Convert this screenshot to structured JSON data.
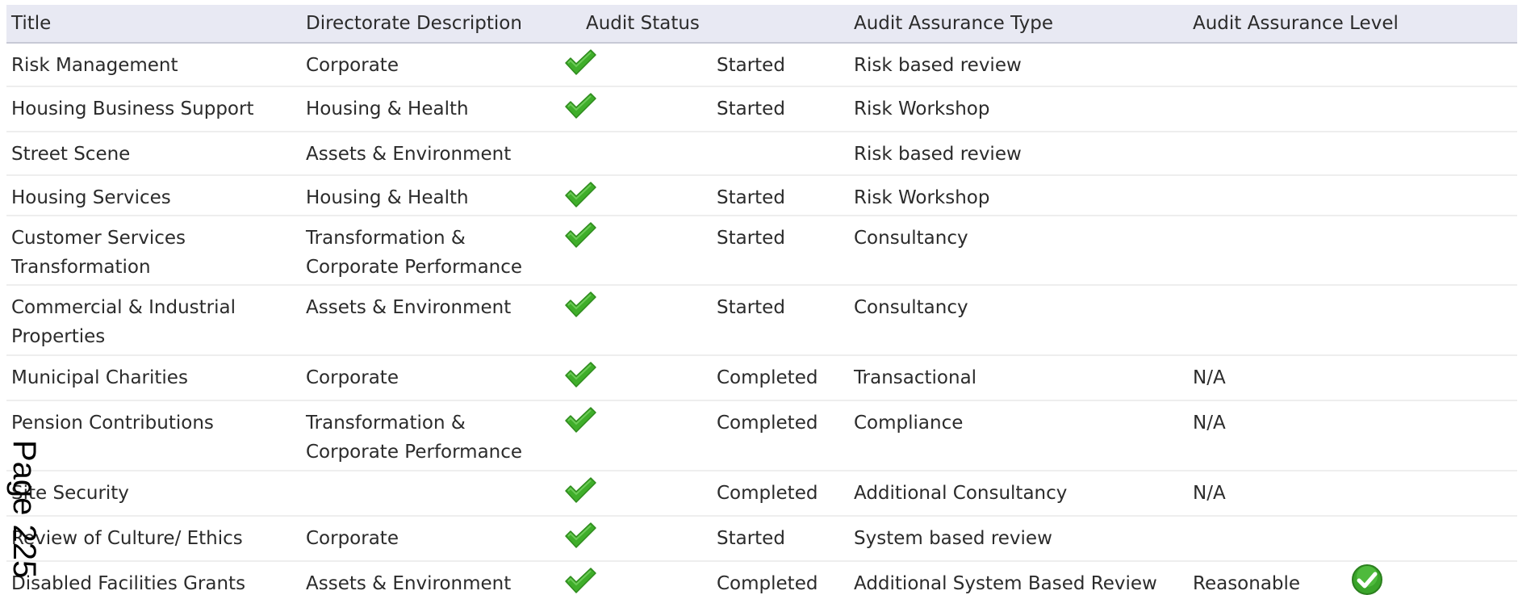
{
  "table": {
    "headers": {
      "title": "Title",
      "directorate": "Directorate Description",
      "status": "Audit Status",
      "type": "Audit Assurance Type",
      "level": "Audit Assurance Level"
    },
    "rows": [
      {
        "title": "Risk Management",
        "directorate": "Corporate",
        "check": true,
        "status": "Started",
        "type": "Risk based review",
        "level": ""
      },
      {
        "title": "Housing Business Support",
        "directorate": "Housing & Health",
        "check": true,
        "status": "Started",
        "type": "Risk Workshop",
        "level": ""
      },
      {
        "title": "Street Scene",
        "directorate": "Assets & Environment",
        "check": false,
        "status": "",
        "type": "Risk based review",
        "level": ""
      },
      {
        "title": "Housing Services",
        "directorate": "Housing & Health",
        "check": true,
        "status": "Started",
        "type": "Risk Workshop",
        "level": ""
      },
      {
        "title": "Customer Services Transformation",
        "directorate": "Transformation & Corporate Performance",
        "check": true,
        "status": "Started",
        "type": "Consultancy",
        "level": ""
      },
      {
        "title": "Commercial & Industrial Properties",
        "directorate": "Assets & Environment",
        "check": true,
        "status": "Started",
        "type": "Consultancy",
        "level": ""
      },
      {
        "title": "Municipal Charities",
        "directorate": "Corporate",
        "check": true,
        "status": "Completed",
        "type": "Transactional",
        "level": "N/A"
      },
      {
        "title": "Pension Contributions",
        "directorate": "Transformation & Corporate Performance",
        "check": true,
        "status": "Completed",
        "type": "Compliance",
        "level": "N/A"
      },
      {
        "title": "Site Security",
        "directorate": "",
        "check": true,
        "status": "Completed",
        "type": "Additional Consultancy",
        "level": "N/A"
      },
      {
        "title": "Review of Culture/ Ethics",
        "directorate": "Corporate",
        "check": true,
        "status": "Started",
        "type": "System based review",
        "level": ""
      },
      {
        "title": "Disabled Facilities Grants",
        "directorate": "Assets & Environment",
        "check": true,
        "status": "Completed",
        "type": "Additional System Based Review",
        "level": "Reasonable",
        "level_icon": "round-check-icon"
      }
    ]
  },
  "page_number": "Page 225",
  "colors": {
    "header_bg": "#e8e9f3",
    "check_green": "#3fae2a"
  }
}
